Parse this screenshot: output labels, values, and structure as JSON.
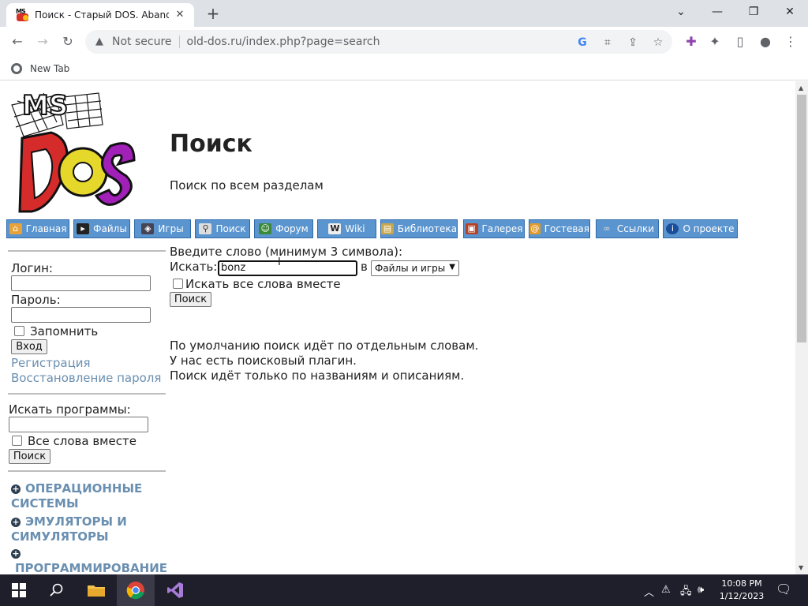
{
  "browser": {
    "tab_title": "Поиск - Старый DOS. Abandonware",
    "not_secure": "Not secure",
    "url": "old-dos.ru/index.php?page=search",
    "bookmark": "New Tab"
  },
  "page": {
    "title": "Поиск",
    "subtitle": "Поиск по всем разделам",
    "nav": [
      {
        "label": "Главная",
        "icon": "home-icon"
      },
      {
        "label": "Файлы",
        "icon": "terminal-icon"
      },
      {
        "label": "Игры",
        "icon": "invader-icon"
      },
      {
        "label": "Поиск",
        "icon": "magnifier-icon"
      },
      {
        "label": "Форум",
        "icon": "person-icon"
      },
      {
        "label": "Wiki",
        "icon": "wiki-icon"
      },
      {
        "label": "Библиотека",
        "icon": "book-icon"
      },
      {
        "label": "Галерея",
        "icon": "picture-icon"
      },
      {
        "label": "Гостевая",
        "icon": "guestbook-icon"
      },
      {
        "label": "Ссылки",
        "icon": "link-icon"
      },
      {
        "label": "О проекте",
        "icon": "info-icon"
      }
    ],
    "sidebar": {
      "login_label": "Логин:",
      "password_label": "Пароль:",
      "remember_label": "Запомнить",
      "login_button": "Вход",
      "register_link": "Регистрация",
      "restore_link": "Восстановление пароля",
      "program_search_label": "Искать программы:",
      "all_words_label": "Все слова вместе",
      "search_button": "Поиск",
      "categories": [
        [
          "ОПЕРАЦИОННЫЕ",
          "СИСТЕМЫ"
        ],
        [
          "ЭМУЛЯТОРЫ И",
          "СИМУЛЯТОРЫ"
        ],
        [
          "",
          "ПРОГРАММИРОВАНИЕ"
        ]
      ]
    },
    "search_form": {
      "prompt": "Введите слово (минимум 3 символа):",
      "search_label": "Искать:",
      "query": "bonz",
      "in_label": "в",
      "scope_selected": "Файлы и игры",
      "all_words_label": "Искать все слова вместе",
      "submit_label": "Поиск"
    },
    "info_lines": [
      "По умолчанию поиск идёт по отдельным словам.",
      "У нас есть поисковый плагин.",
      "Поиск идёт только по названиям и описаниям."
    ]
  },
  "taskbar": {
    "time": "10:08 PM",
    "date": "1/12/2023"
  }
}
